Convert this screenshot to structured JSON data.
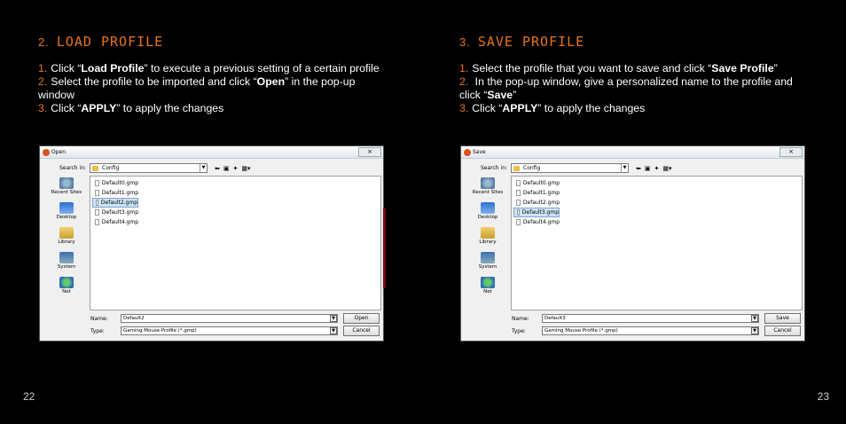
{
  "left": {
    "section_number": "2.",
    "section_title": "LOAD PROFILE",
    "steps": [
      {
        "n": "1.",
        "pre": "Click “",
        "bold": "Load Profile",
        "post": "” to execute a previous setting of a certain profile"
      },
      {
        "n": "2.",
        "pre": "Select the profile to be imported and click “",
        "bold": "Open",
        "post": "” in the pop-up window"
      },
      {
        "n": "3.",
        "pre": "Click “",
        "bold": "APPLY",
        "post": "” to apply the changes"
      }
    ],
    "page_number": "22",
    "dialog": {
      "title": "Open",
      "close": "×",
      "look_in_label": "Search in:",
      "look_in_value": "Config",
      "places": [
        "Recent Sites",
        "Desktop",
        "Library",
        "System",
        "Net"
      ],
      "files": [
        "Default0.gmp",
        "Default1.gmp",
        "Default2.gmp",
        "Default3.gmp",
        "Default4.gmp"
      ],
      "selected_index": 2,
      "name_label": "Name:",
      "name_value": "Default2",
      "type_label": "Type:",
      "type_value": "Gaming  Mouse Profile (*.gmp)",
      "primary_button": "Open",
      "cancel_button": "Cancel"
    }
  },
  "right": {
    "section_number": "3.",
    "section_title": "SAVE PROFILE",
    "steps": [
      {
        "n": "1.",
        "pre": "Select the profile that you want to save and click “",
        "bold": "Save Profile",
        "post": "”"
      },
      {
        "n": "2.",
        "pre": " In the pop-up window, give a personalized name to the profile and click “",
        "bold": "Save",
        "post": "”"
      },
      {
        "n": "3.",
        "pre": "Click “",
        "bold": "APPLY",
        "post": "” to apply the changes"
      }
    ],
    "page_number": "23",
    "dialog": {
      "title": "Save",
      "close": "×",
      "look_in_label": "Search in:",
      "look_in_value": "Config",
      "places": [
        "Recent Sites",
        "Desktop",
        "Library",
        "System",
        "Net"
      ],
      "files": [
        "Default0.gmp",
        "Default1.gmp",
        "Default2.gmp",
        "Default3.gmp",
        "Default4.gmp"
      ],
      "selected_index": 3,
      "name_label": "Name:",
      "name_value": "Default3",
      "type_label": "Type:",
      "type_value": "Gaming  Mouse Profile (*.gmp)",
      "primary_button": "Save",
      "cancel_button": "Cancel"
    }
  },
  "colors": {
    "accent": "#e8731c",
    "background": "#000000"
  }
}
